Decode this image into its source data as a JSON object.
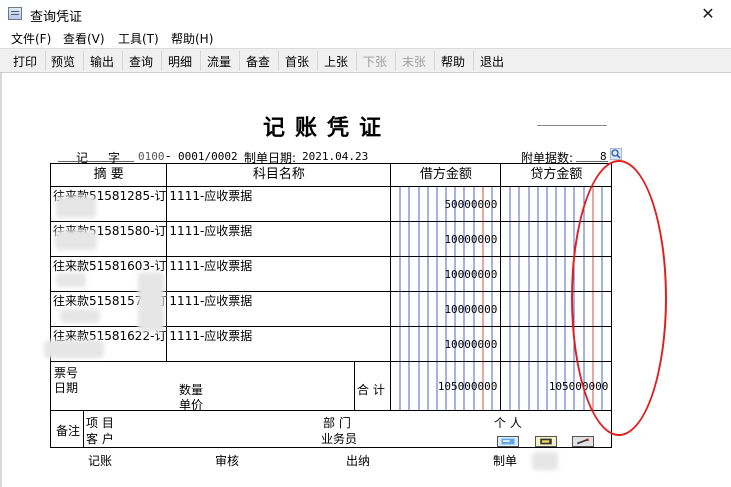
{
  "window": {
    "title": "查询凭证",
    "close_glyph": "✕"
  },
  "menu": [
    "文件(F)",
    "查看(V)",
    "工具(T)",
    "帮助(H)"
  ],
  "toolbar": [
    {
      "label": "打印",
      "enabled": true
    },
    {
      "label": "预览",
      "enabled": true
    },
    {
      "label": "输出",
      "enabled": true
    },
    {
      "label": "查询",
      "enabled": true
    },
    {
      "label": "明细",
      "enabled": true
    },
    {
      "label": "流量",
      "enabled": true
    },
    {
      "label": "备查",
      "enabled": true
    },
    {
      "label": "首张",
      "enabled": true
    },
    {
      "label": "上张",
      "enabled": true
    },
    {
      "label": "下张",
      "enabled": false
    },
    {
      "label": "末张",
      "enabled": false
    },
    {
      "label": "帮助",
      "enabled": true
    },
    {
      "label": "退出",
      "enabled": true
    }
  ],
  "voucher": {
    "title": "记账凭证",
    "type_char": "记",
    "zi": "字",
    "type_code": "0100",
    "dash": "-",
    "number": "0001/0002",
    "date_label": "制单日期:",
    "date": "2021.04.23",
    "attach_label": "附单据数:",
    "attach_count": "8",
    "headers": {
      "summary": "摘 要",
      "account": "科目名称",
      "debit": "借方金额",
      "credit": "贷方金额"
    },
    "rows": [
      {
        "summary": "往来款51581285-订",
        "account": "1111-应收票据",
        "debit": "50000000",
        "credit": ""
      },
      {
        "summary": "往来款51581580-订",
        "account": "1111-应收票据",
        "debit": "10000000",
        "credit": ""
      },
      {
        "summary": "往来款51581603-订",
        "account": "1111-应收票据",
        "debit": "10000000",
        "credit": ""
      },
      {
        "summary": "往来款51581574-订",
        "account": "1111-应收票据",
        "debit": "10000000",
        "credit": ""
      },
      {
        "summary": "往来款51581622-订",
        "account": "1111-应收票据",
        "debit": "10000000",
        "credit": ""
      }
    ],
    "footer": {
      "ticket_no": "票号",
      "date": "日期",
      "quantity": "数量",
      "unit_price": "单价",
      "total_label": "合 计",
      "total_debit": "105000000",
      "total_credit": "105000000"
    },
    "remarks": {
      "label": "备注",
      "project": "项  目",
      "customer": "客  户",
      "department": "部  门",
      "salesperson": "业务员",
      "individual": "个  人"
    },
    "signatures": {
      "bookkeeping": "记账",
      "audit": "审核",
      "cashier": "出纳",
      "maker": "制单"
    }
  },
  "colors": {
    "annotation": "#e02020",
    "grid_blue": "#1f3fbf",
    "grid_red": "#c81e1e",
    "toolbar_bg": "#f0f0f0"
  }
}
